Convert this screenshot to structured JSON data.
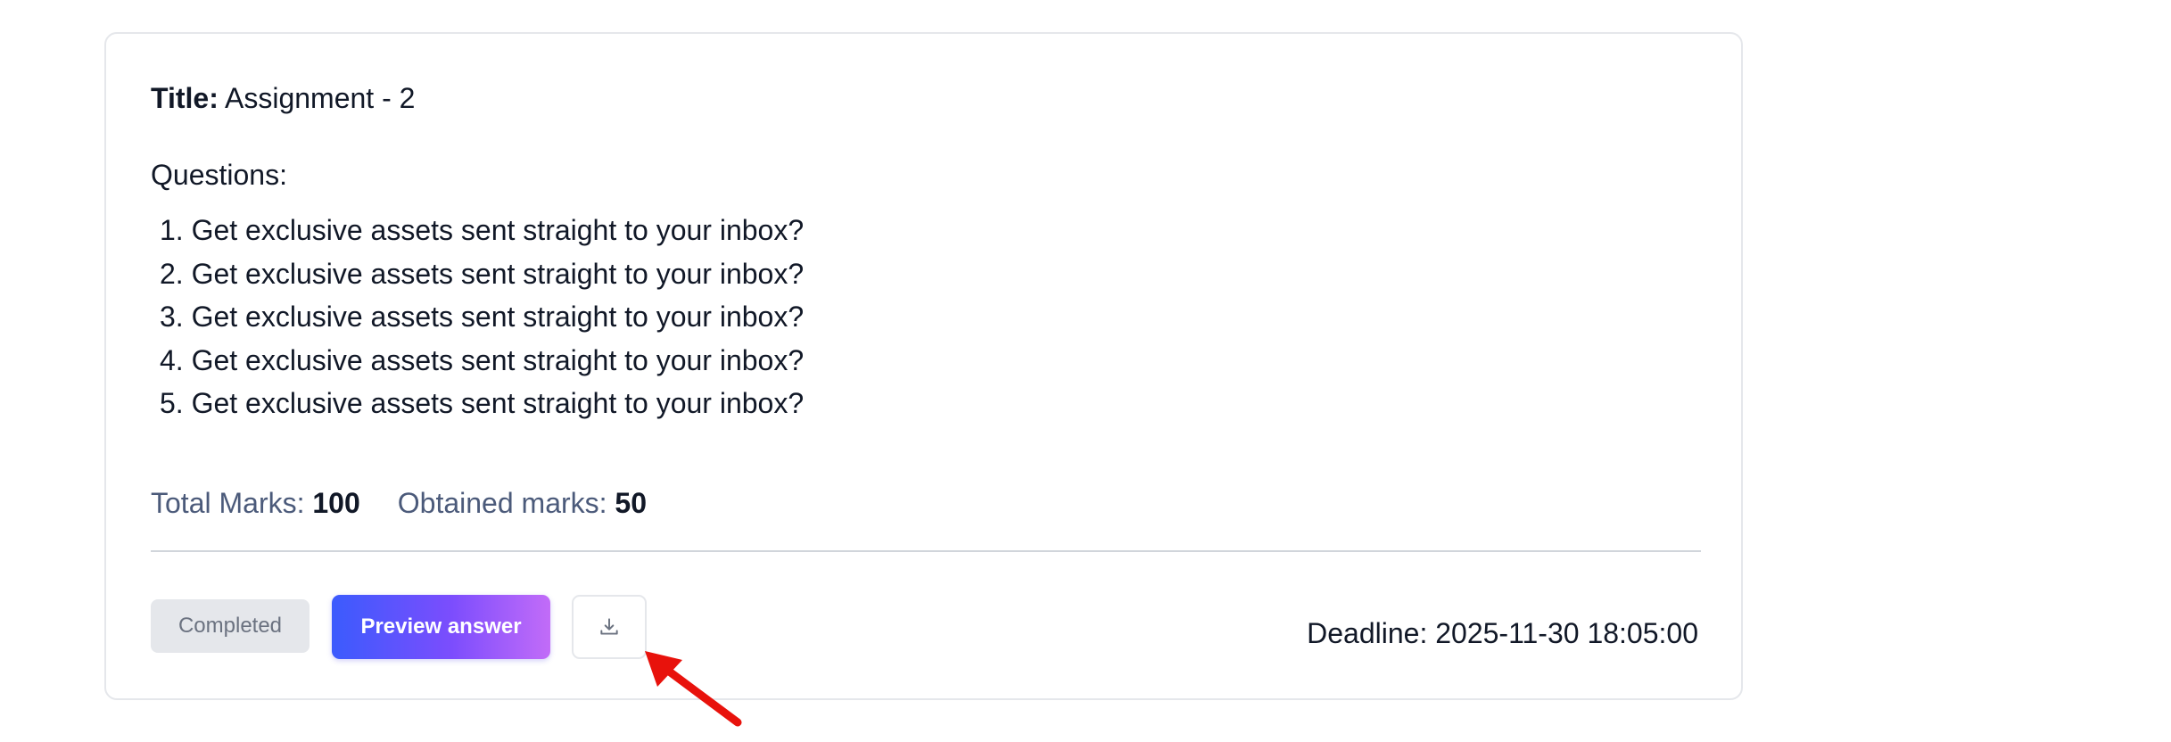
{
  "assignment": {
    "title_label": "Title:",
    "title_value": " Assignment - 2",
    "questions_label": "Questions:",
    "questions": [
      "1. Get exclusive assets sent straight to your inbox?",
      "2. Get exclusive assets sent straight to your inbox?",
      "3. Get exclusive assets sent straight to your inbox?",
      "4. Get exclusive assets sent straight to your inbox?",
      "5. Get exclusive assets sent straight to your inbox?"
    ],
    "total_marks_label": "Total Marks:",
    "total_marks_value": "100",
    "obtained_marks_label": "Obtained marks:",
    "obtained_marks_value": "50",
    "status_label": "Completed",
    "preview_button_label": "Preview answer",
    "download_icon": "download-icon",
    "deadline_text": "Deadline: 2025-11-30 18:05:00"
  },
  "colors": {
    "preview_gradient_start": "#3b5bfd",
    "preview_gradient_end": "#c26cf8",
    "annotation_arrow": "#e8120c",
    "muted_label": "#4b5a7a"
  }
}
